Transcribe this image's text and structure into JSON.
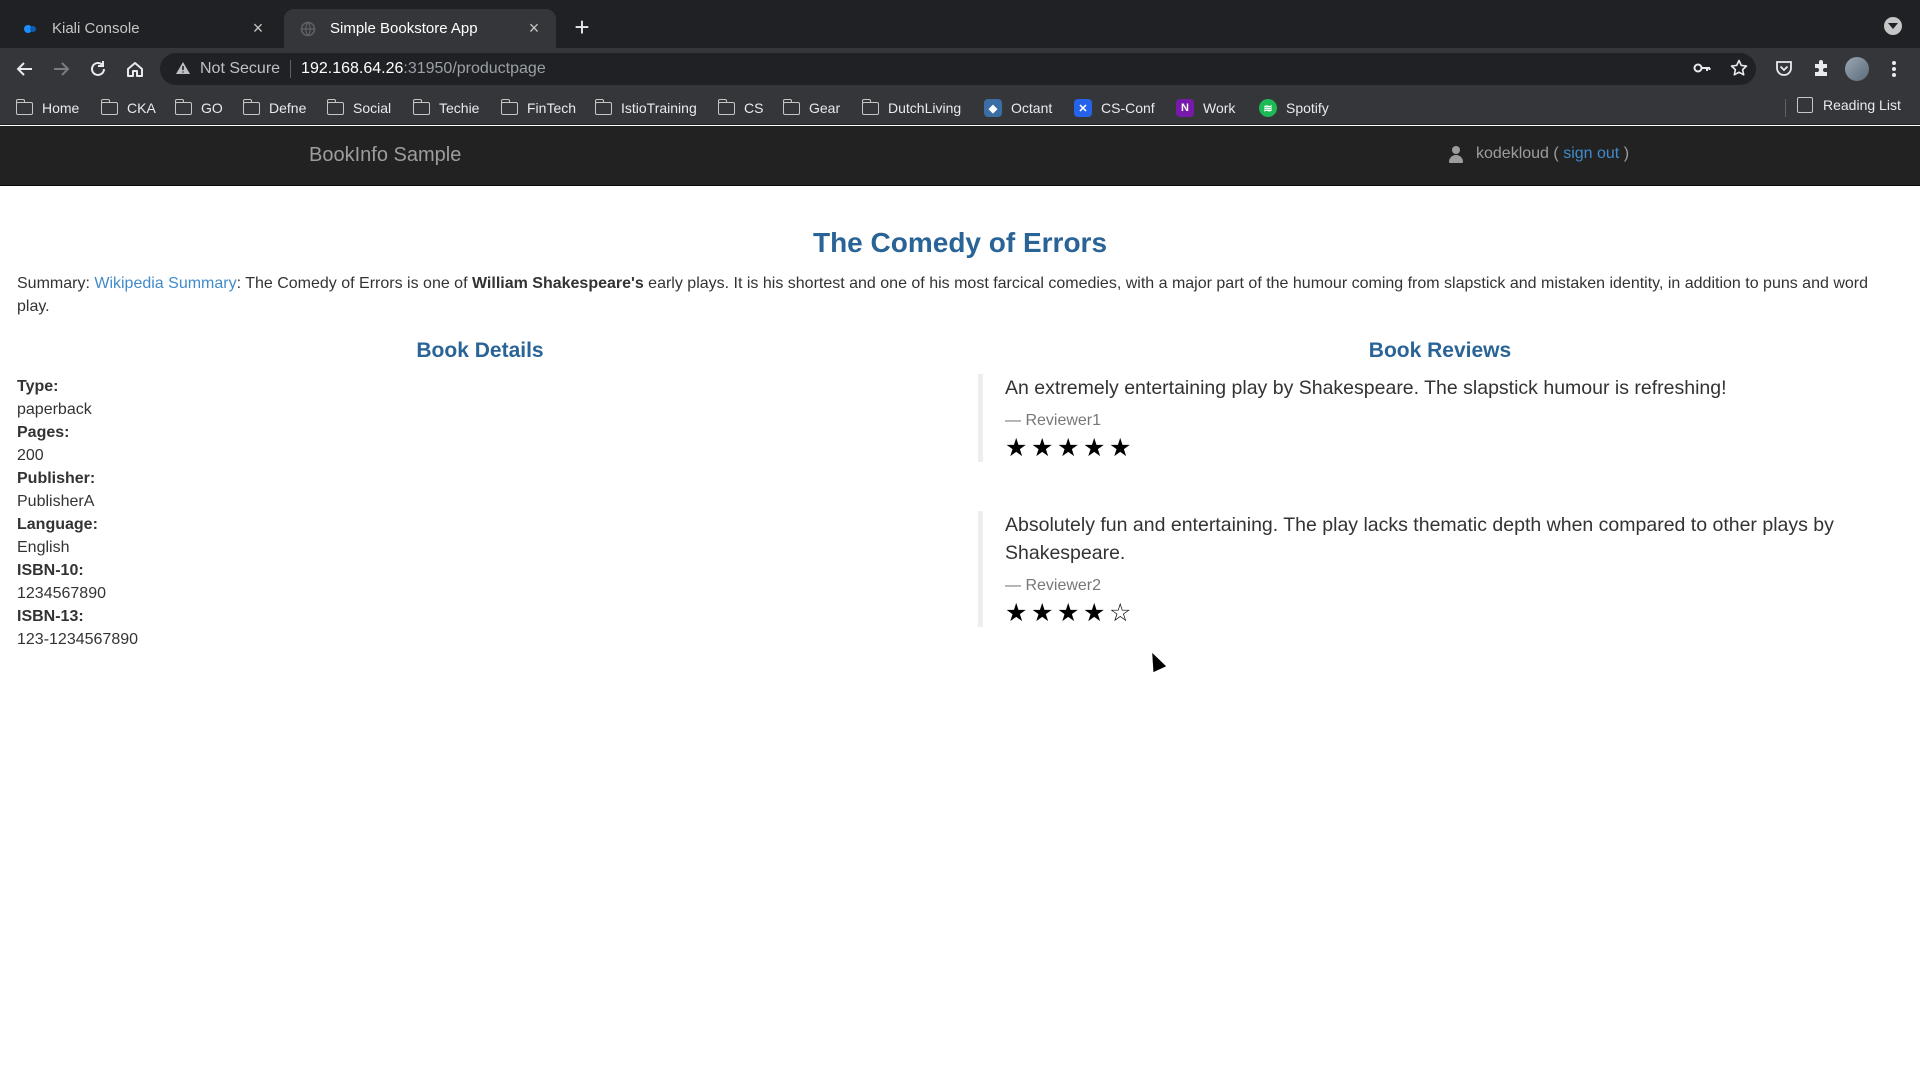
{
  "browser": {
    "tabs": [
      {
        "title": "Kiali Console",
        "close": "×"
      },
      {
        "title": "Simple Bookstore App",
        "close": "×"
      }
    ],
    "new_tab": "+",
    "omnibox": {
      "security_label": "Not Secure",
      "url_host": "192.168.64.26",
      "url_rest": ":31950/productpage"
    },
    "bookmarks": [
      "Home",
      "CKA",
      "GO",
      "Defne",
      "Social",
      "Techie",
      "FinTech",
      "IstioTraining",
      "CS",
      "Gear",
      "DutchLiving",
      "Octant",
      "CS-Conf",
      "Work",
      "Spotify"
    ],
    "reading_list": "Reading List"
  },
  "navbar": {
    "brand": "BookInfo Sample",
    "user": "kodekloud",
    "open_paren": "(",
    "sign_out": "sign out",
    "close_paren": ")"
  },
  "book": {
    "title": "The Comedy of Errors",
    "summary_prefix": "Summary: ",
    "summary_link": "Wikipedia Summary",
    "summary_a": ": The Comedy of Errors is one of ",
    "summary_bold": "William Shakespeare's",
    "summary_b": " early plays. It is his shortest and one of his most farcical comedies, with a major part of the humour coming from slapstick and mistaken identity, in addition to puns and word play."
  },
  "details": {
    "heading": "Book Details",
    "fields": [
      {
        "label": "Type:",
        "value": "paperback"
      },
      {
        "label": "Pages:",
        "value": "200"
      },
      {
        "label": "Publisher:",
        "value": "PublisherA"
      },
      {
        "label": "Language:",
        "value": "English"
      },
      {
        "label": "ISBN-10:",
        "value": "1234567890"
      },
      {
        "label": "ISBN-13:",
        "value": "123-1234567890"
      }
    ]
  },
  "reviews": {
    "heading": "Book Reviews",
    "items": [
      {
        "text": "An extremely entertaining play by Shakespeare. The slapstick humour is refreshing!",
        "author": "— Reviewer1",
        "rating": 5,
        "max_rating": 5
      },
      {
        "text": "Absolutely fun and entertaining. The play lacks thematic depth when compared to other plays by Shakespeare.",
        "author": "— Reviewer2",
        "rating": 4,
        "max_rating": 5
      }
    ]
  }
}
